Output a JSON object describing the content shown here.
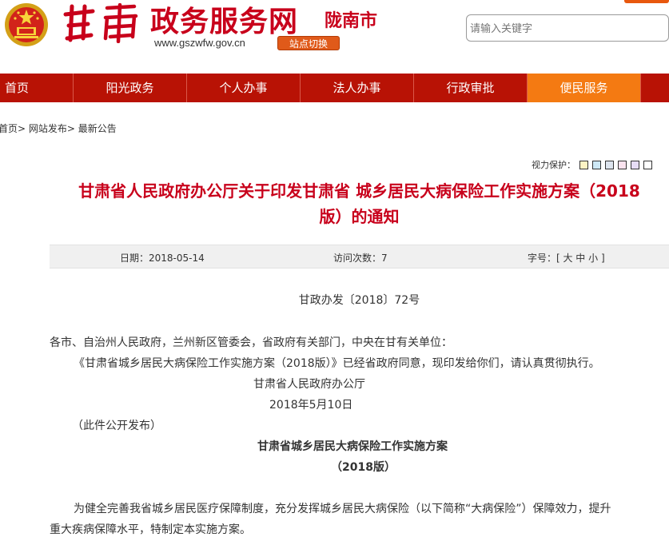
{
  "header": {
    "site_name": "政务服务网",
    "city_name": "陇南市",
    "url": "www.gszwfw.gov.cn",
    "switch_label": "站点切换",
    "search_placeholder": "请输入关键字"
  },
  "nav": {
    "items": [
      "首页",
      "阳光政务",
      "个人办事",
      "法人办事",
      "行政审批",
      "便民服务"
    ],
    "active_index": 5
  },
  "breadcrumb": [
    "首页",
    "网站发布",
    "最新公告"
  ],
  "vision_protection": {
    "label": "视力保护：",
    "swatches": [
      "#fdf3c4",
      "#cde8f5",
      "#dde4ee",
      "#fbe3ef",
      "#e6dcf5",
      "#ffffff"
    ]
  },
  "article": {
    "title_line1": "甘肃省人民政府办公厅关于印发甘肃省 城乡居民大病保险工作实施方案（2018",
    "title_line2": "版）的通知",
    "date": "日期：2018-05-14",
    "visits": "访问次数：7",
    "font_size": "字号：[ 大 中 小 ]",
    "doc_number": "甘政办发〔2018〕72号",
    "addressee": "各市、自治州人民政府，兰州新区管委会，省政府有关部门，中央在甘有关单位：",
    "body1": "《甘肃省城乡居民大病保险工作实施方案（2018版）》已经省政府同意，现印发给你们，请认真贯彻执行。",
    "issuer": "甘肃省人民政府办公厅",
    "issue_date": "2018年5月10日",
    "public_note": "（此件公开发布）",
    "plan_title": "甘肃省城乡居民大病保险工作实施方案",
    "plan_subtitle": "（2018版）",
    "para1_line1": "为健全完善我省城乡居民医疗保障制度，充分发挥城乡居民大病保险（以下简称“大病保险”）保障效力，提升",
    "para1_line2": "重大疾病保障水平，特制定本实施方案。"
  },
  "colors": {
    "brand_red": "#c8001b",
    "nav_red": "#b81205",
    "nav_active": "#f47a12"
  }
}
